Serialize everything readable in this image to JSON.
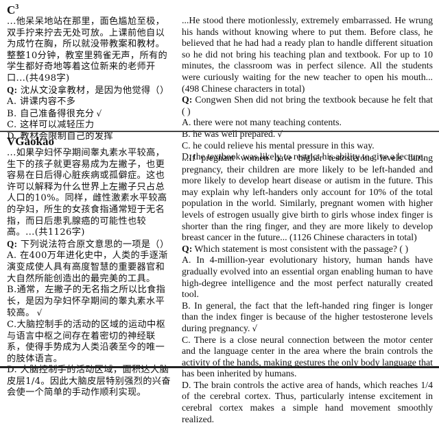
{
  "sections": [
    {
      "title": "C",
      "title_sup": "3",
      "zh": {
        "passage": "...他呆呆地站在那里，面色尴尬至极，双手拧来拧去无处可放。上课前他自以为成竹在胸，所以就没带教案和教材。整整10分钟，教室里鸦雀无声，所有的学生都好奇地等着这位新来的老师开口...(共498字)",
        "q_label": "Q:",
        "question": "沈从文没拿教材，是因为他觉得（）",
        "options": [
          "A. 讲课内容不多",
          "B. 自己准备得很充分",
          "C. 这样可以减轻压力",
          "D. 教材会限制自己的发挥"
        ]
      },
      "en": {
        "passage": "...He stood there motionlessly, extremely embarrassed. He wrung his hands without knowing where to put them. Before class, he believed that he had had a ready plan to handle different situation so he did not bring his teaching plan and textbook. For up to 10 minutes, the classroom was in perfect silence. All the students were curiously waiting for the new teacher to open his mouth... (498 Chinese characters in total)",
        "q_label": "Q:",
        "question": "Congwen Shen did not bring the textbook because he felt that ( )",
        "options": [
          "A. there were not many teaching contents.",
          "B. he was well prepared.",
          "C. he could relieve his mental pressure in this way.",
          "D. the textbook was likely to restrict his ability to give a lecture."
        ]
      },
      "correct_option_index": 1,
      "check_mark": "√"
    },
    {
      "title": "VGaokao",
      "title_sup": "",
      "zh": {
        "passage": "...如果孕妇怀孕期间睾丸素水平较高，生下的孩子就更容易成为左撇子，也更容易在日后得心脏疾病或孤僻症。这也许可以解释为什么世界上左撇子只占总人口的10%。同样，雌性激素水平较高的孕妇，所生的女孩食指通常短于无名指，而日后患乳腺癌的可能性也较高。...(共1126字)",
        "q_label": "Q:",
        "question": "下列说法符合原文意思的一项是（）",
        "options": [
          "A. 在400万年进化史中，人类的手逐渐演变成使人具有高度智慧的重要器官和大自然所能创造出的最完美的工具。",
          "B.通常，左撇子的无名指之所以比食指长，是因为孕妇怀孕期间的睾丸素水平较高。",
          "C.大脑控制手的活动的区域的运动中枢与语言中枢之间存在着密切的神经联系，使得手势成为人类沿袭至今的唯一的肢体语言。",
          "D. 大脑控制手的活动区域，面积达大脑皮层1/4。因此大脑皮层特别强烈的兴奋会使一个简单的手动作顺利实现。"
        ]
      },
      "en": {
        "passage": "...If pregnant women have higher testosterone levels during pregnancy, their children are more likely to be left-handed and more likely to develop heart disease or autism in the future. This may explain why left-handers only account for 10% of the total population in the world. Similarly, pregnant women with higher levels of estrogen usually give birth to girls whose index finger is shorter than the ring finger, and they are more likely to develop breast cancer in the future... (1126 Chinese characters in total)",
        "q_label": "Q:",
        "question": "Which statement is most consistent with the passage? ( )",
        "options": [
          "A. In 4-million-year evolutionary history, human hands have gradually evolved into an essential organ enabling human to have high-degree intelligence and the most perfect naturally created tool.",
          "B. In general, the fact that the left-handed ring finger is longer than the index finger is because of the higher testosterone levels during pregnancy.",
          "C. There is a close neural connection between the motor center and the language center in the area where the brain controls the activity of the hands, making gestures the only body language that has been inherited by humans.",
          "D. The brain controls the active area of hands, which reaches 1/4 of the cerebral cortex. Thus, particularly intense excitement in cerebral cortex makes a simple hand movement smoothly realized."
        ]
      },
      "correct_option_index": 1,
      "check_mark": "√"
    }
  ]
}
